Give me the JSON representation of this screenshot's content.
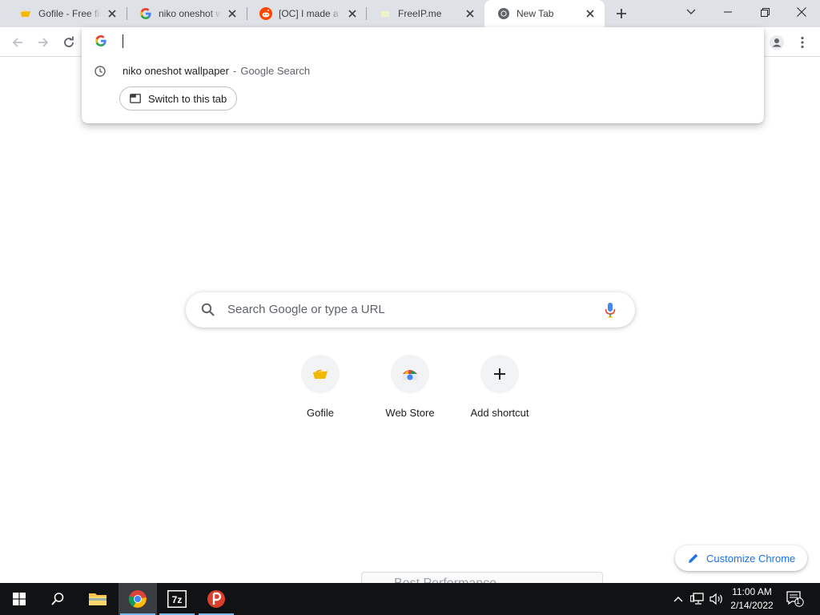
{
  "tabs": [
    {
      "title": "Gofile - Free file sharing",
      "icon": "gofile-favicon",
      "active": false
    },
    {
      "title": "niko oneshot wallpaper - Google Search",
      "icon": "google-favicon",
      "active": false
    },
    {
      "title": "[OC] I made a minimal wallpaper",
      "icon": "reddit-favicon",
      "active": false
    },
    {
      "title": "FreeIP.me",
      "icon": "freeip-favicon",
      "active": false
    },
    {
      "title": "New Tab",
      "icon": "chrome-favicon",
      "active": true
    }
  ],
  "omnibox": {
    "value": "",
    "suggestion": {
      "query": "niko oneshot wallpaper",
      "separator": "-",
      "source": "Google Search",
      "icon": "history-clock-icon"
    },
    "switch_label": "Switch to this tab"
  },
  "ntp": {
    "search_placeholder": "Search Google or type a URL",
    "shortcuts": [
      {
        "label": "Gofile",
        "icon": "gofile-icon"
      },
      {
        "label": "Web Store",
        "icon": "web-store-icon"
      },
      {
        "label": "Add shortcut",
        "icon": "plus-icon"
      }
    ],
    "customize_label": "Customize Chrome"
  },
  "background_window_text": "Best Performance",
  "taskbar": {
    "time": "11:00 AM",
    "date": "2/14/2022",
    "notification_count": "1",
    "apps": [
      "start",
      "search",
      "file-explorer",
      "chrome",
      "7zip",
      "psiphon"
    ]
  },
  "colors": {
    "tabstrip": "#dee1e6",
    "accent_blue": "#1a73e8",
    "taskbar": "#101214"
  }
}
